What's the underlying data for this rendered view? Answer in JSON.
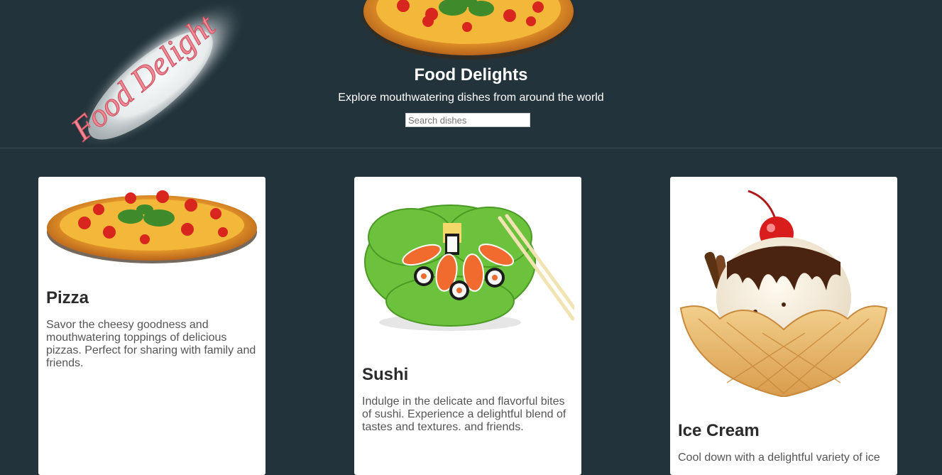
{
  "logo": {
    "text": "Food Delight"
  },
  "header": {
    "title": "Food Delights",
    "subtitle": "Explore mouthwatering dishes from around the world",
    "search_placeholder": "Search dishes"
  },
  "dishes": [
    {
      "name": "Pizza",
      "description": "Savor the cheesy goodness and mouthwatering toppings of delicious pizzas. Perfect for sharing with family and friends."
    },
    {
      "name": "Sushi",
      "description": "Indulge in the delicate and flavorful bites of sushi. Experience a delightful blend of tastes and textures. and friends."
    },
    {
      "name": "Ice Cream",
      "description": "Cool down with a delightful variety of ice"
    }
  ],
  "colors": {
    "background": "#22333b",
    "card": "#ffffff",
    "title_text": "#2b2b2b",
    "body_text": "#555555"
  }
}
